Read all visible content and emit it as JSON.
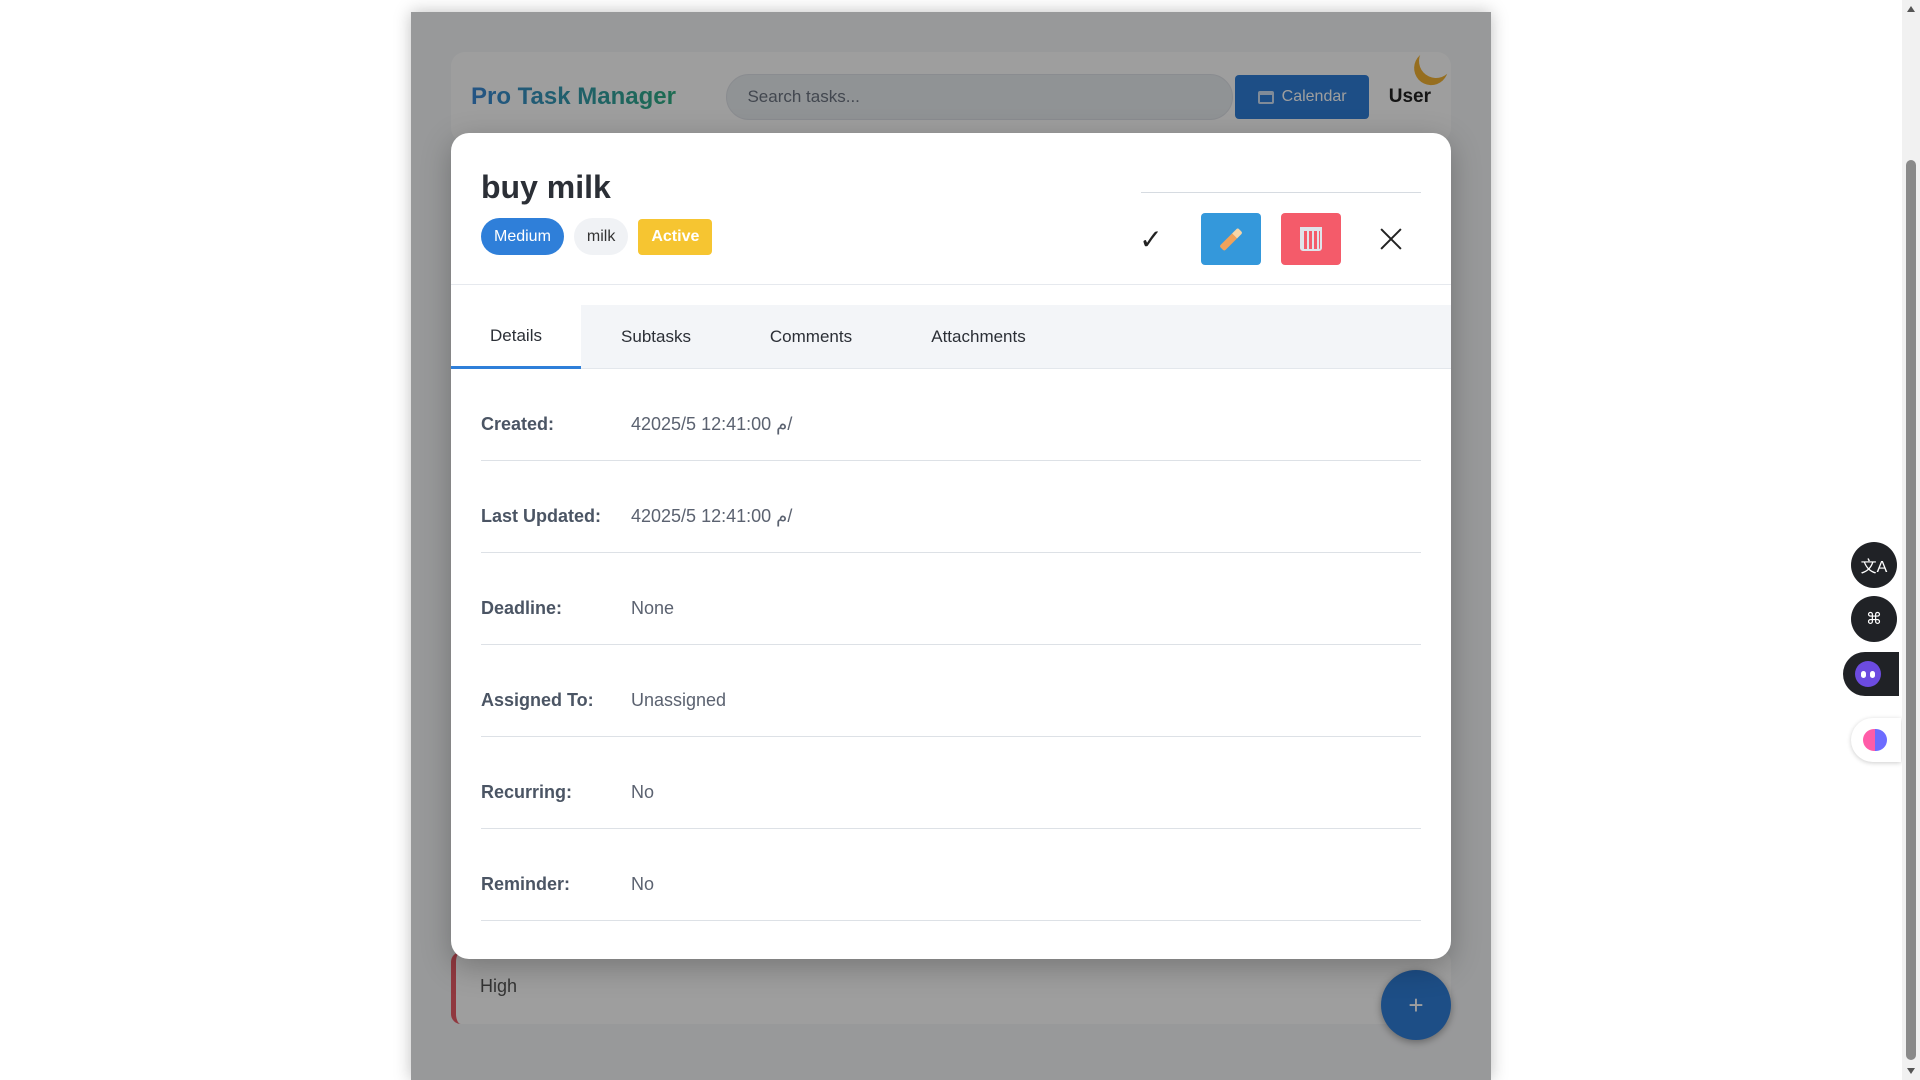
{
  "app": {
    "title": "Pro Task Manager",
    "search_placeholder": "Search tasks...",
    "calendar_label": "Calendar",
    "user_label": "User",
    "theme_icon": "moon-icon",
    "background_card_text": "High",
    "fab_label": "+"
  },
  "modal": {
    "task_title": "buy milk",
    "tags": {
      "priority": "Medium",
      "label": "milk",
      "status": "Active"
    },
    "actions": {
      "complete": "✓",
      "edit_icon": "pencil-icon",
      "delete_icon": "trash-icon",
      "close_icon": "close-icon"
    },
    "tabs": [
      "Details",
      "Subtasks",
      "Comments",
      "Attachments"
    ],
    "active_tab": "Details",
    "details": [
      {
        "label": "Created:",
        "value": "4م 12:41:00 2025/5/"
      },
      {
        "label": "Last Updated:",
        "value": "4م 12:41:00 2025/5/"
      },
      {
        "label": "Deadline:",
        "value": "None"
      },
      {
        "label": "Assigned To:",
        "value": "Unassigned"
      },
      {
        "label": "Recurring:",
        "value": "No"
      },
      {
        "label": "Reminder:",
        "value": "No"
      }
    ]
  },
  "colors": {
    "accent": "#2f7fd9",
    "status_active": "#f6c531",
    "delete": "#f45b6a",
    "edit": "#3498db"
  },
  "side_widgets": [
    "translate-icon",
    "apps-icon",
    "robot-icon",
    "brain-icon"
  ]
}
